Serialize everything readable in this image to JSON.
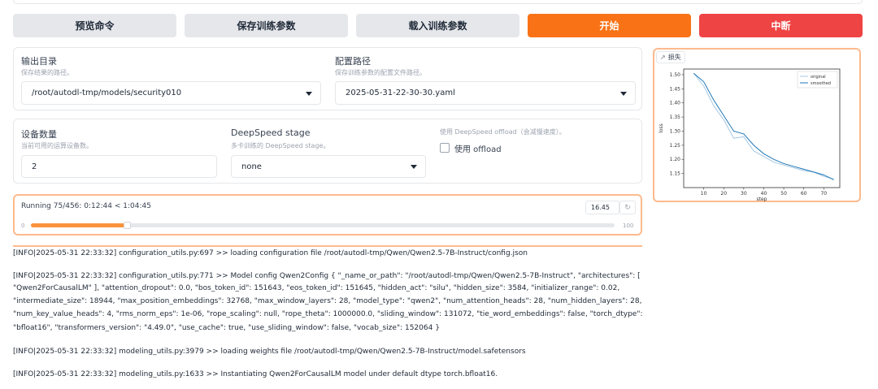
{
  "toolbar": {
    "preview_label": "预览命令",
    "save_label": "保存训练参数",
    "load_label": "载入训练参数",
    "start_label": "开始",
    "abort_label": "中断"
  },
  "output_dir": {
    "label": "输出目录",
    "hint": "保存结果的路径。",
    "value": "/root/autodl-tmp/models/security010"
  },
  "config_path": {
    "label": "配置路径",
    "hint": "保存训练参数的配置文件路径。",
    "value": "2025-05-31-22-30-30.yaml"
  },
  "device_count": {
    "label": "设备数量",
    "hint": "当前可用的运算设备数。",
    "value": "2"
  },
  "deepspeed": {
    "label": "DeepSpeed stage",
    "hint": "多卡训练的 DeepSpeed stage。",
    "value": "none"
  },
  "offload": {
    "hint": "使用 DeepSpeed offload（会减慢速度）。",
    "label": "使用 offload",
    "checked": false
  },
  "progress": {
    "status": "Running 75/456: 0:12:44 < 1:04:45",
    "slider_value": "16.45",
    "min_label": "0",
    "max_label": "100",
    "percent": 16.45
  },
  "loss_panel": {
    "tab_label": "损失"
  },
  "chart_data": {
    "type": "line",
    "title": "",
    "xlabel": "step",
    "ylabel": "loss",
    "xlim": [
      0,
      78
    ],
    "ylim": [
      1.1,
      1.52
    ],
    "x_ticks": [
      "10",
      "20",
      "30",
      "40",
      "50",
      "60",
      "70"
    ],
    "y_ticks": [
      "1.15",
      "1.20",
      "1.25",
      "1.30",
      "1.35",
      "1.40",
      "1.45",
      "1.50"
    ],
    "legend_position": "top-right",
    "series": [
      {
        "name": "original",
        "color": "#a5c8e4",
        "x": [
          5,
          10,
          15,
          20,
          25,
          30,
          35,
          40,
          45,
          50,
          55,
          60,
          65,
          70,
          75
        ],
        "y": [
          1.505,
          1.46,
          1.39,
          1.34,
          1.275,
          1.28,
          1.23,
          1.21,
          1.19,
          1.18,
          1.17,
          1.16,
          1.155,
          1.14,
          1.13
        ]
      },
      {
        "name": "smoothed",
        "color": "#1f77b4",
        "x": [
          5,
          10,
          15,
          20,
          25,
          30,
          35,
          40,
          45,
          50,
          55,
          60,
          65,
          70,
          75
        ],
        "y": [
          1.505,
          1.475,
          1.41,
          1.355,
          1.3,
          1.29,
          1.25,
          1.22,
          1.2,
          1.185,
          1.175,
          1.165,
          1.155,
          1.145,
          1.128
        ]
      }
    ]
  },
  "logs": [
    "[INFO|2025-05-31 22:33:32] configuration_utils.py:697 >> loading configuration file /root/autodl-tmp/Qwen/Qwen2.5-7B-Instruct/config.json",
    "[INFO|2025-05-31 22:33:32] configuration_utils.py:771 >> Model config Qwen2Config { \"_name_or_path\": \"/root/autodl-tmp/Qwen/Qwen2.5-7B-Instruct\", \"architectures\": [",
    "\"Qwen2ForCausalLM\" ], \"attention_dropout\": 0.0, \"bos_token_id\": 151643, \"eos_token_id\": 151645, \"hidden_act\": \"silu\", \"hidden_size\": 3584, \"initializer_range\": 0.02,",
    "\"intermediate_size\": 18944, \"max_position_embeddings\": 32768, \"max_window_layers\": 28, \"model_type\": \"qwen2\", \"num_attention_heads\": 28, \"num_hidden_layers\": 28,",
    "\"num_key_value_heads\": 4, \"rms_norm_eps\": 1e-06, \"rope_scaling\": null, \"rope_theta\": 1000000.0, \"sliding_window\": 131072, \"tie_word_embeddings\": false, \"torch_dtype\":",
    "\"bfloat16\", \"transformers_version\": \"4.49.0\", \"use_cache\": true, \"use_sliding_window\": false, \"vocab_size\": 152064 }",
    "[INFO|2025-05-31 22:33:32] modeling_utils.py:3979 >> loading weights file /root/autodl-tmp/Qwen/Qwen2.5-7B-Instruct/model.safetensors",
    "[INFO|2025-05-31 22:33:32] modeling_utils.py:1633 >> Instantiating Qwen2ForCausalLM model under default dtype torch.bfloat16."
  ]
}
